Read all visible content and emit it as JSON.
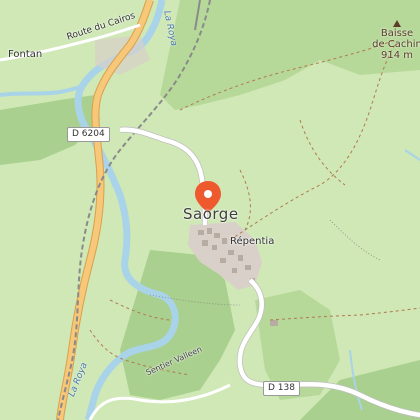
{
  "map": {
    "labels": {
      "town": "Saorge",
      "hamlet": "Répentia",
      "fontan": "Fontan",
      "route_cairos": "Route du Cairos",
      "river_top": "La Roya",
      "river_bottom": "La Roya",
      "trail": "Sentier Valleen",
      "d6204": "D 6204",
      "d138": "D 138",
      "peak_name_1": "Baisse",
      "peak_name_2": "de Cachin",
      "peak_elev": "914 m"
    },
    "icons": {
      "marker": "location-pin-icon",
      "peak": "peak-triangle-icon"
    },
    "colors": {
      "background": "#cfe8b5",
      "forest": "#a9d08e",
      "water": "#a9d3e8",
      "main_road": "#f7c77a",
      "road_casing": "#d9a14b",
      "minor_road": "#ffffff",
      "railway": "#888888",
      "marker": "#ee5a2e",
      "built_area": "#d9d0c9"
    }
  }
}
